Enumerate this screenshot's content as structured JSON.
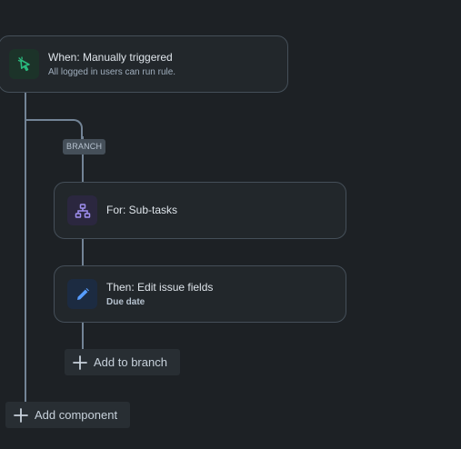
{
  "trigger": {
    "title": "When: Manually triggered",
    "subtitle": "All logged in users can run rule.",
    "icon": "cursor-click-icon",
    "accent": "#2abb7f"
  },
  "branch": {
    "tag": "BRANCH",
    "for_card": {
      "title": "For: Sub-tasks",
      "icon": "hierarchy-icon",
      "accent": "#9f8fef"
    },
    "then_card": {
      "title": "Then: Edit issue fields",
      "subtitle": "Due date",
      "icon": "pencil-icon",
      "accent": "#579dff"
    },
    "add_label": "Add to branch"
  },
  "add_component_label": "Add component",
  "colors": {
    "background": "#1d2125",
    "card": "#22272b",
    "connector": "#738496"
  }
}
